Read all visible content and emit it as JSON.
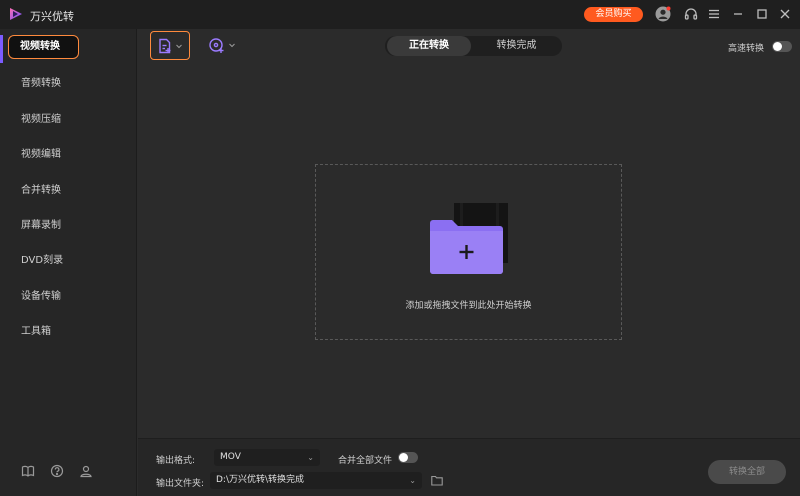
{
  "app": {
    "title": "万兴优转"
  },
  "titlebar": {
    "vip_label": "会员购买"
  },
  "sidebar": {
    "items": [
      {
        "label": "视频转换",
        "active": true
      },
      {
        "label": "音频转换"
      },
      {
        "label": "视频压缩"
      },
      {
        "label": "视频编辑"
      },
      {
        "label": "合并转换"
      },
      {
        "label": "屏幕录制"
      },
      {
        "label": "DVD刻录"
      },
      {
        "label": "设备传输"
      },
      {
        "label": "工具箱"
      }
    ],
    "footer_icons": [
      "book-icon",
      "help-icon",
      "account-icon"
    ]
  },
  "toolbar": {
    "tabs": [
      {
        "label": "正在转换",
        "active": true
      },
      {
        "label": "转换完成"
      }
    ],
    "high_speed_label": "高速转换",
    "high_speed_on": false
  },
  "dropzone": {
    "hint": "添加或拖拽文件到此处开始转换"
  },
  "footer": {
    "format_label": "输出格式:",
    "format_value": "MOV",
    "merge_label": "合并全部文件",
    "merge_on": false,
    "folder_label": "输出文件夹:",
    "folder_value": "D:\\万兴优转\\转换完成",
    "convert_all_label": "转换全部"
  },
  "colors": {
    "accent": "#ff8a3d",
    "brand_purple": "#7c5cff",
    "vip": "#ff5a1f"
  }
}
